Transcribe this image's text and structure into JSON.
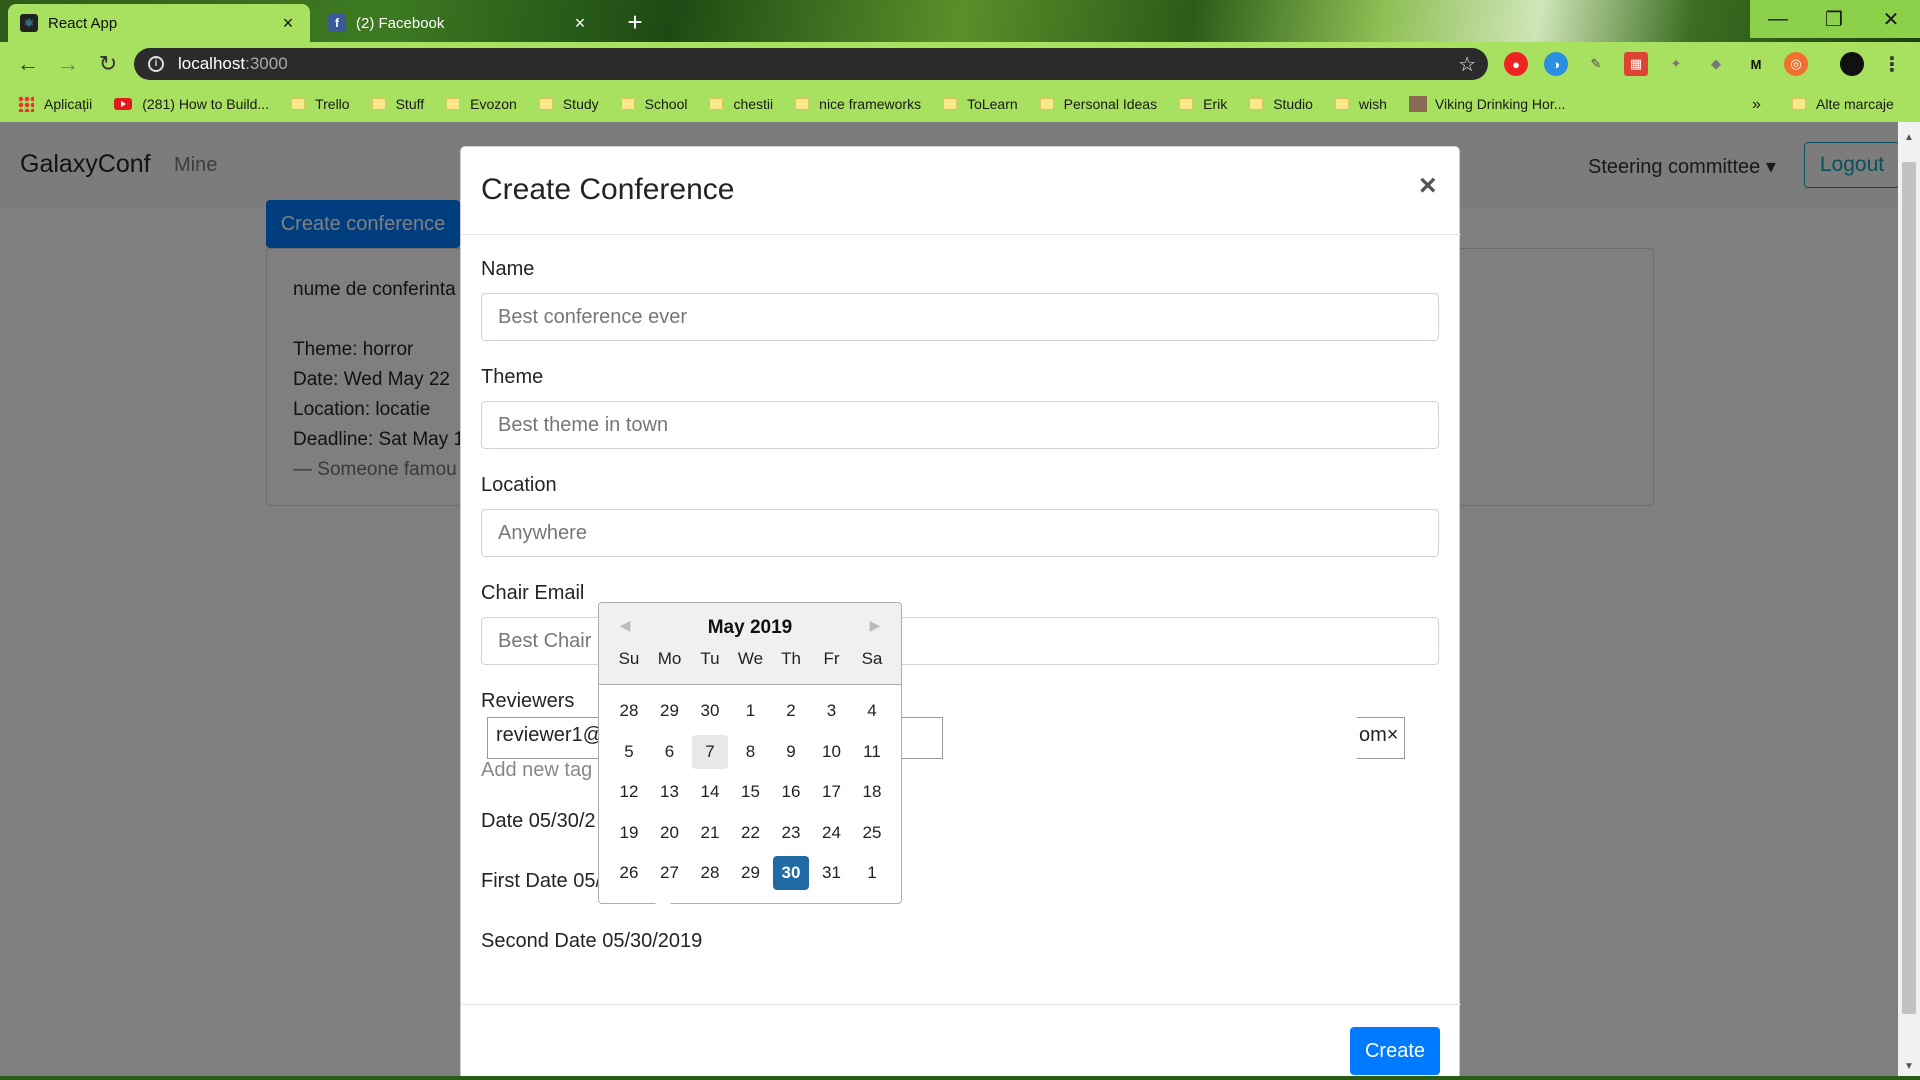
{
  "browser": {
    "tabs": [
      {
        "title": "React App",
        "active": true
      },
      {
        "title": "(2) Facebook",
        "active": false
      }
    ],
    "url_host": "localhost",
    "url_port": ":3000",
    "bookmarks": [
      {
        "label": "Aplicații",
        "icon": "apps-icon"
      },
      {
        "label": "(281) How to Build...",
        "icon": "youtube-icon"
      },
      {
        "label": "Trello",
        "icon": "folder-icon"
      },
      {
        "label": "Stuff",
        "icon": "folder-icon"
      },
      {
        "label": "Evozon",
        "icon": "folder-icon"
      },
      {
        "label": "Study",
        "icon": "folder-icon"
      },
      {
        "label": "School",
        "icon": "folder-icon"
      },
      {
        "label": "chestii",
        "icon": "folder-icon"
      },
      {
        "label": "nice frameworks",
        "icon": "folder-icon"
      },
      {
        "label": "ToLearn",
        "icon": "folder-icon"
      },
      {
        "label": "Personal Ideas",
        "icon": "folder-icon"
      },
      {
        "label": "Erik",
        "icon": "folder-icon"
      },
      {
        "label": "Studio",
        "icon": "folder-icon"
      },
      {
        "label": "wish",
        "icon": "folder-icon"
      },
      {
        "label": "Viking Drinking Hor...",
        "icon": "image-icon"
      }
    ],
    "more_bookmarks": "»",
    "other_bookmarks": "Alte marcaje"
  },
  "navbar": {
    "brand": "GalaxyConf",
    "mine": "Mine",
    "steering": "Steering committee ▾",
    "logout": "Logout"
  },
  "page": {
    "create_button": "Create conference",
    "card": {
      "name": "nume de conferinta",
      "theme": "Theme: horror",
      "date": "Date: Wed May 22",
      "location": "Location: locatie",
      "deadline": "Deadline: Sat May 1",
      "quote": "— Someone famou"
    }
  },
  "modal": {
    "title": "Create Conference",
    "close": "×",
    "fields": {
      "name_label": "Name",
      "name_placeholder": "Best conference ever",
      "theme_label": "Theme",
      "theme_placeholder": "Best theme in town",
      "location_label": "Location",
      "location_placeholder": "Anywhere",
      "chair_label": "Chair Email",
      "chair_placeholder": "Best Chair",
      "reviewers_label": "Reviewers",
      "reviewer_tag_start": "reviewer1@",
      "reviewer_tag_end": "om×",
      "add_tag": "Add new tag",
      "date": "Date 05/30/2",
      "first_date": "First Date 05/",
      "second_date": "Second Date 05/30/2019"
    },
    "submit": "Create"
  },
  "datepicker": {
    "month": "May 2019",
    "weekdays": [
      "Su",
      "Mo",
      "Tu",
      "We",
      "Th",
      "Fr",
      "Sa"
    ],
    "weeks": [
      [
        "28",
        "29",
        "30",
        "1",
        "2",
        "3",
        "4"
      ],
      [
        "5",
        "6",
        "7",
        "8",
        "9",
        "10",
        "11"
      ],
      [
        "12",
        "13",
        "14",
        "15",
        "16",
        "17",
        "18"
      ],
      [
        "19",
        "20",
        "21",
        "22",
        "23",
        "24",
        "25"
      ],
      [
        "26",
        "27",
        "28",
        "29",
        "30",
        "31",
        "1"
      ]
    ],
    "selected": "30",
    "keyboard_focus": "7"
  },
  "colors": {
    "primary": "#007bff",
    "selected_day": "#216ba5",
    "chrome_accent": "#a8e05f"
  }
}
